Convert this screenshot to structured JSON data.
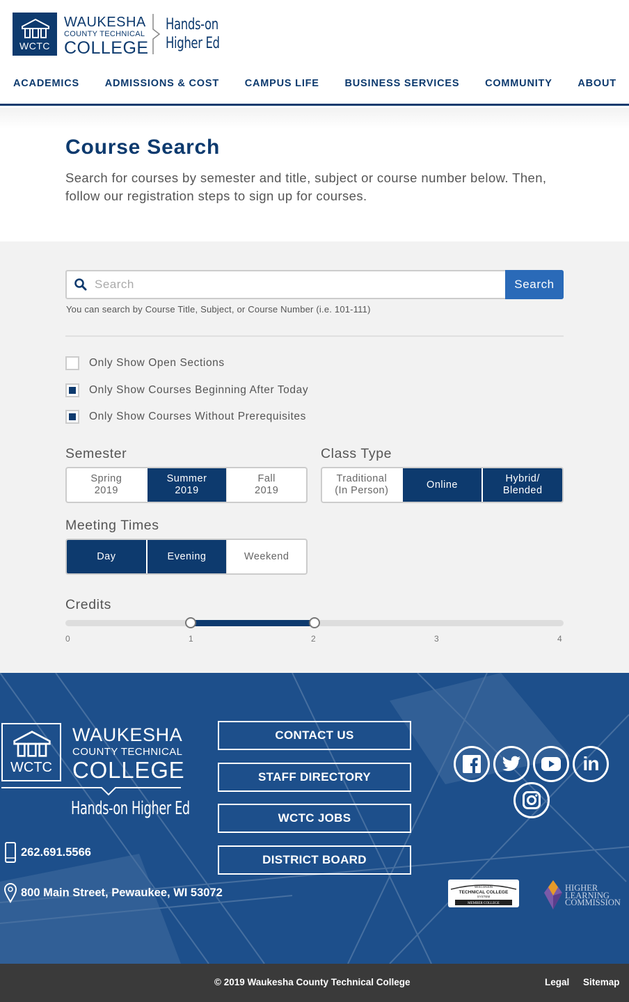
{
  "header": {
    "logo": {
      "abbr": "WCTC",
      "line1": "WAUKESHA",
      "line2": "COUNTY TECHNICAL",
      "line3": "COLLEGE",
      "tagline_1": "Hands-on",
      "tagline_2": "Higher Ed"
    },
    "nav": [
      "ACADEMICS",
      "ADMISSIONS & COST",
      "CAMPUS LIFE",
      "BUSINESS SERVICES",
      "COMMUNITY",
      "ABOUT"
    ]
  },
  "intro": {
    "title": "Course Search",
    "description": "Search for courses by semester and title, subject or course number below. Then, follow our registration steps to sign up for courses."
  },
  "search": {
    "placeholder": "Search",
    "button_label": "Search",
    "hint": "You can search by Course Title, Subject, or Course Number (i.e. 101-111)"
  },
  "filters": {
    "checkboxes": [
      {
        "label": "Only Show Open Sections",
        "checked": false
      },
      {
        "label": "Only Show Courses Beginning After Today",
        "checked": true
      },
      {
        "label": "Only Show Courses Without Prerequisites",
        "checked": true
      }
    ],
    "semester": {
      "label": "Semester",
      "options": [
        {
          "label": "Spring\n2019",
          "selected": false
        },
        {
          "label": "Summer\n2019",
          "selected": true
        },
        {
          "label": "Fall\n2019",
          "selected": false
        }
      ]
    },
    "class_type": {
      "label": "Class Type",
      "options": [
        {
          "label": "Traditional\n(In Person)",
          "selected": false
        },
        {
          "label": "Online",
          "selected": true
        },
        {
          "label": "Hybrid/\nBlended",
          "selected": true
        }
      ]
    },
    "meeting_times": {
      "label": "Meeting Times",
      "options": [
        {
          "label": "Day",
          "selected": true
        },
        {
          "label": "Evening",
          "selected": true
        },
        {
          "label": "Weekend",
          "selected": false
        }
      ]
    },
    "credits": {
      "label": "Credits",
      "min": 0,
      "max": 4,
      "ticks": [
        "0",
        "1",
        "2",
        "3",
        "4"
      ],
      "range_low": 1,
      "range_high": 2
    }
  },
  "footer": {
    "logo": {
      "abbr": "WCTC",
      "line1": "WAUKESHA",
      "line2": "COUNTY TECHNICAL",
      "line3": "COLLEGE",
      "tagline": "Hands-on Higher Ed"
    },
    "phone": "262.691.5566",
    "address": "800 Main Street, Pewaukee, WI 53072",
    "buttons": [
      "CONTACT US",
      "STAFF DIRECTORY",
      "WCTC JOBS",
      "DISTRICT BOARD"
    ],
    "social": [
      "facebook-icon",
      "twitter-icon",
      "youtube-icon",
      "linkedin-icon",
      "instagram-icon"
    ],
    "badges": {
      "wtcs_line1": "WISCONSIN",
      "wtcs_line2": "TECHNICAL COLLEGE",
      "wtcs_line3": "SYSTEM",
      "wtcs_line4": "MEMBER COLLEGE",
      "hlc_line1": "HIGHER",
      "hlc_line2": "LEARNING",
      "hlc_line3": "COMMISSION"
    }
  },
  "bottom_bar": {
    "copyright": "©  2019 Waukesha County Technical College",
    "legal": "Legal",
    "sitemap": "Sitemap"
  },
  "colors": {
    "brand": "#0d3a6e",
    "accent": "#2a6ab8",
    "footer_bg": "#1d4f8b",
    "bottom_bar": "#3a3a3a"
  }
}
